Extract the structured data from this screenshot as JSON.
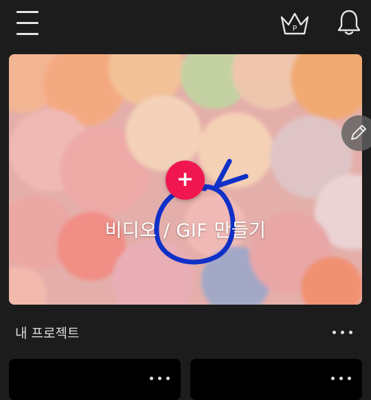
{
  "header": {
    "crown_badge": "P"
  },
  "hero": {
    "create_label": "비디오 / GIF 만들기",
    "add_symbol": "+"
  },
  "projects": {
    "section_title": "내 프로젝트"
  },
  "colors": {
    "background": "#1c1c1c",
    "accent": "#f0164f",
    "scribble": "#1030c8",
    "card": "#000000"
  }
}
